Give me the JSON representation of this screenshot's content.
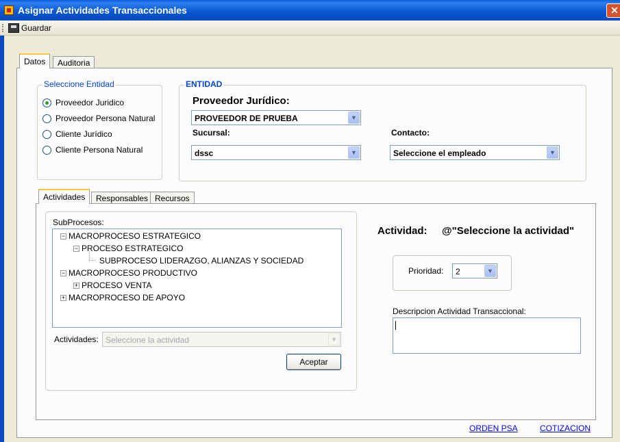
{
  "window": {
    "title": "Asignar Actividades Transaccionales",
    "close_glyph": "✕"
  },
  "toolbar": {
    "save_label": "Guardar"
  },
  "main_tabs": [
    {
      "label": "Datos",
      "active": true
    },
    {
      "label": "Auditoria",
      "active": false
    }
  ],
  "entity_selector": {
    "legend": "Seleccione Entidad",
    "options": [
      {
        "label": "Proveedor Juridico",
        "checked": true
      },
      {
        "label": "Proveedor Persona Natural",
        "checked": false
      },
      {
        "label": "Cliente Jurídico",
        "checked": false
      },
      {
        "label": "Cliente Persona Natural",
        "checked": false
      }
    ]
  },
  "entidad": {
    "legend": "ENTIDAD",
    "proveedor_label": "Proveedor Jurídico:",
    "proveedor_value": "PROVEEDOR DE PRUEBA",
    "sucursal_label": "Sucursal:",
    "sucursal_value": "dssc",
    "contacto_label": "Contacto:",
    "contacto_value": "Seleccione el empleado"
  },
  "inner_tabs": [
    {
      "label": "Actividades",
      "active": true
    },
    {
      "label": "Responsables",
      "active": false
    },
    {
      "label": "Recursos",
      "active": false
    }
  ],
  "subprocesos": {
    "label": "SubProcesos:",
    "tree": [
      {
        "label": "MACROPROCESO ESTRATEGICO",
        "expander": "−"
      },
      {
        "label": "PROCESO ESTRATEGICO",
        "expander": "−"
      },
      {
        "label": "SUBPROCESO LIDERAZGO, ALIANZAS Y SOCIEDAD",
        "expander": ""
      },
      {
        "label": "MACROPROCESO PRODUCTIVO",
        "expander": "−"
      },
      {
        "label": "PROCESO VENTA",
        "expander": "+"
      },
      {
        "label": "MACROPROCESO DE APOYO",
        "expander": "+"
      }
    ]
  },
  "actividades": {
    "label": "Actividades:",
    "value": "Seleccione la actividad",
    "accept_label": "Aceptar"
  },
  "actividad_header": {
    "label": "Actividad:",
    "value": "@\"Seleccione la actividad\""
  },
  "prioridad": {
    "label": "Prioridad:",
    "value": "2"
  },
  "descripcion": {
    "label": "Descripcion Actividad Transaccional:",
    "value": ""
  },
  "links": {
    "orden": "ORDEN PSA",
    "cotizacion": "COTIZACION"
  },
  "icons": {
    "dropdown": "▼"
  }
}
